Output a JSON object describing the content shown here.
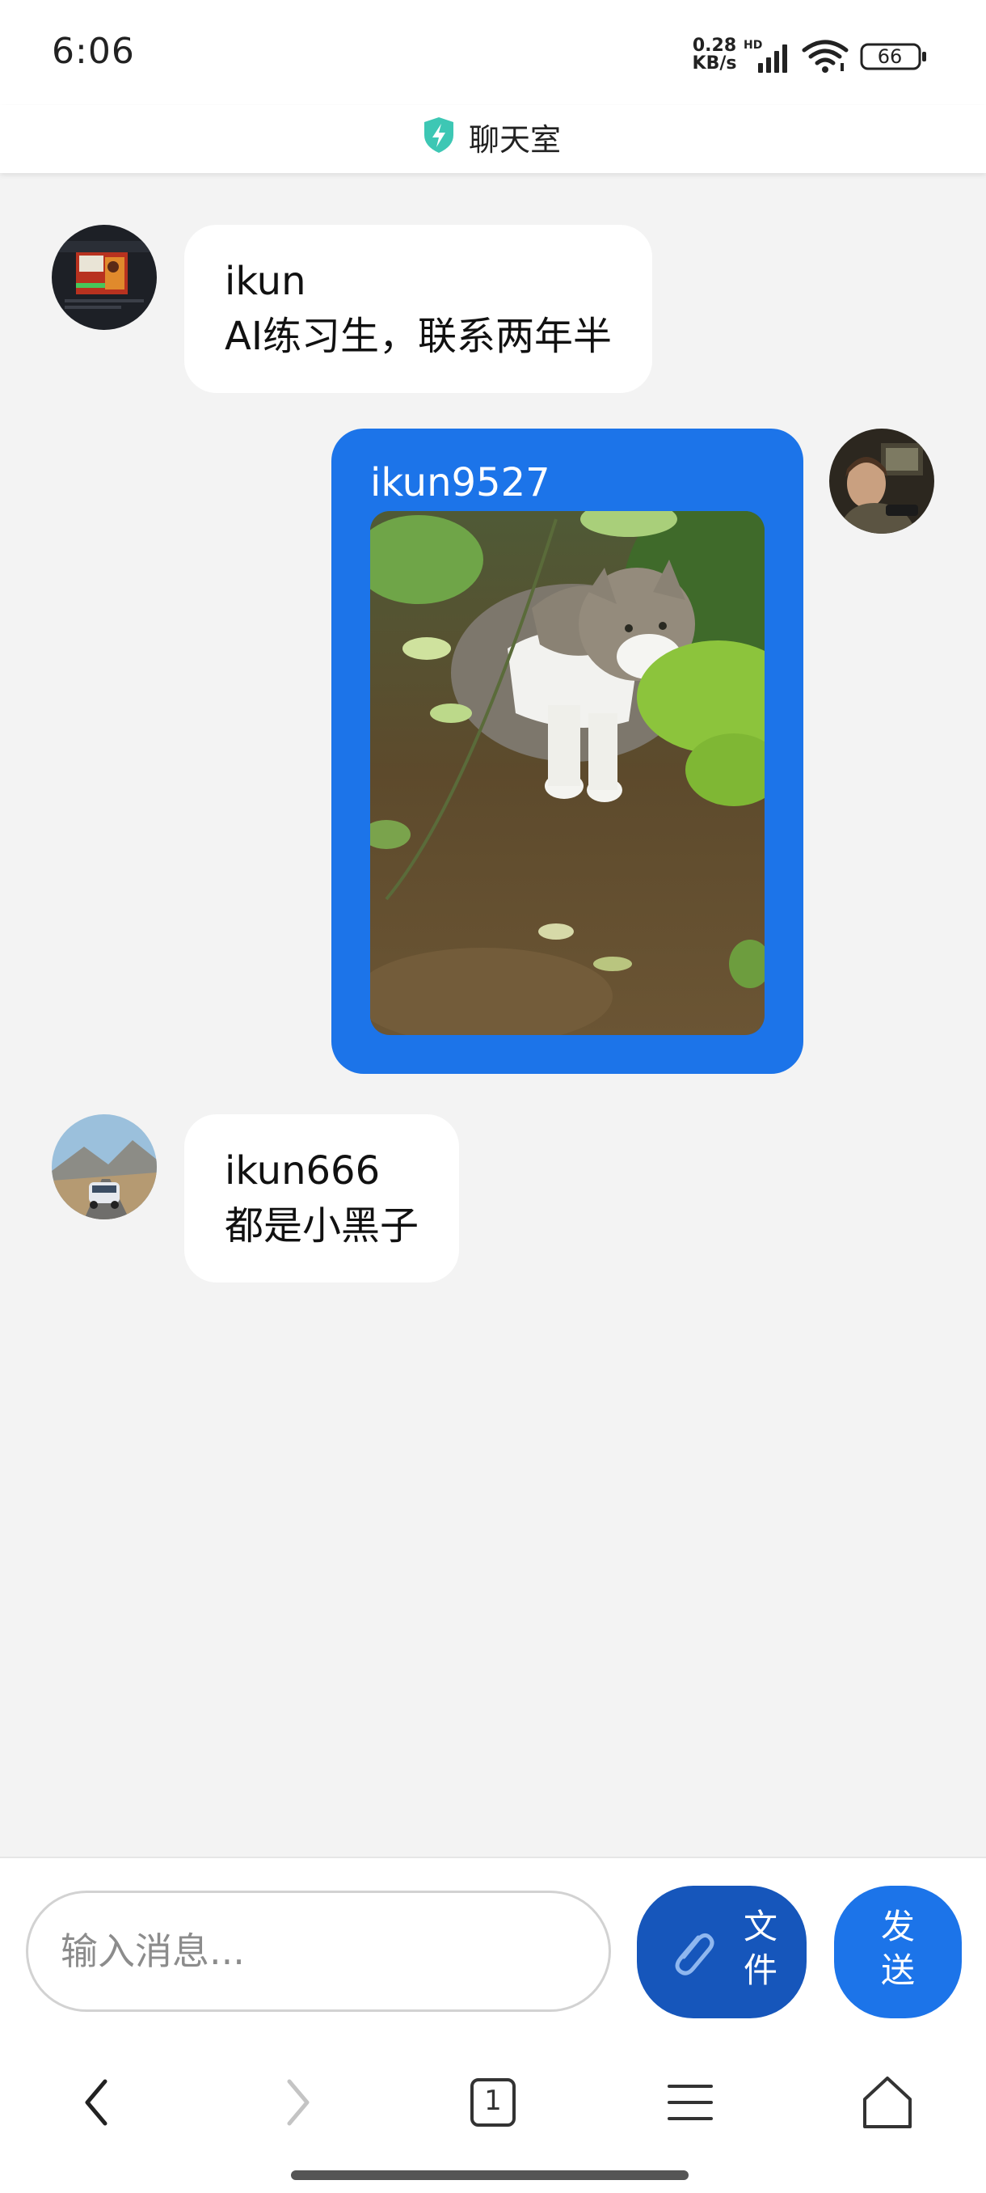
{
  "status_bar": {
    "time": "6:06",
    "net_speed_value": "0.28",
    "net_speed_unit": "KB/s",
    "hd_label": "HD",
    "battery": "66",
    "signal_icon": "signal-bars-icon",
    "wifi_icon": "wifi-icon",
    "battery_icon": "battery-icon"
  },
  "header": {
    "title": "聊天室",
    "icon": "shield-lightning-icon",
    "icon_color": "#3dc7b4"
  },
  "messages": [
    {
      "direction": "received",
      "sender": "ikun",
      "text": "AI练习生，联系两年半",
      "avatar": "game-cover-avatar"
    },
    {
      "direction": "sent",
      "sender": "ikun9527",
      "image": "cat-photo",
      "avatar": "person-avatar",
      "bubble_color": "#1c74e9"
    },
    {
      "direction": "received",
      "sender": "ikun666",
      "text": "都是小黑子",
      "avatar": "car-road-avatar"
    }
  ],
  "composer": {
    "placeholder": "输入消息...",
    "file_button_label": "文件",
    "file_button_icon": "paperclip-icon",
    "file_button_color": "#1656bb",
    "send_button_label": "发送",
    "send_button_color": "#1c74e9"
  },
  "browser_nav": {
    "tab_count": "1",
    "back_icon": "back-arrow-icon",
    "forward_icon": "forward-arrow-icon",
    "menu_icon": "menu-icon",
    "home_icon": "home-icon"
  }
}
